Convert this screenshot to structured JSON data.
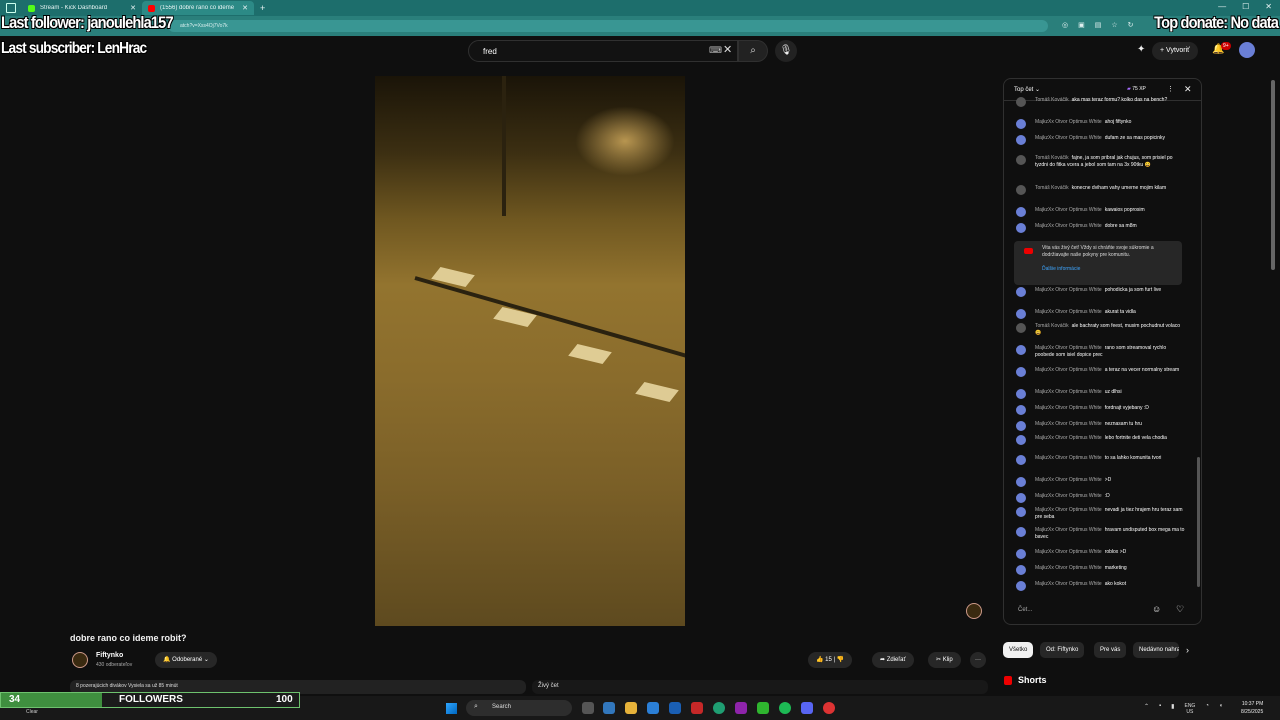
{
  "browser": {
    "tabs": [
      {
        "label": "Stream - Kick Dashboard",
        "color": "#53fc18"
      },
      {
        "label": "(1556) dobre rano co ideme",
        "color": "#ff0000"
      }
    ],
    "url": "atch?v=Xss4Oj7Vo7k"
  },
  "overlay": {
    "last_follower": "Last follower: janoulehla157",
    "last_subscriber": "Last subscriber: LenHrac",
    "top_donate": "Top donate: No data"
  },
  "youtube": {
    "search_value": "fred",
    "create_label": "Vytvoriť",
    "notif_badge": "9+"
  },
  "video": {
    "title": "dobre rano co ideme robit?",
    "channel": "Fiftynko",
    "subscribers": "430 odberateľov",
    "subscribe_label": "Odoberané",
    "likes": "15",
    "share_label": "Zdieľať",
    "clip_label": "Klip",
    "description": "8 pozerajúcich divákov  Vysiela sa už 85 minút",
    "live_chat_label": "Živý čet"
  },
  "chat": {
    "header_title": "Top čet",
    "xp": "75 XP",
    "messages": [
      {
        "author": "Tomáš Kováčik",
        "text": "aka mas teraz formu?  kolko das na bench?",
        "type": "t"
      },
      {
        "author": "MajkzXx Otvor Optimus White",
        "text": "ahoj fiftynko",
        "type": "m"
      },
      {
        "author": "MajkzXx Otvor Optimus White",
        "text": "dufam ze sa mas popicinky",
        "type": "m"
      },
      {
        "author": "Tomáš Kováčik",
        "text": "fajne, ja som pribral jak chujus, som prisiel po tyzdni do fitka vcera a jebol som tam na 3x 90tku 😀",
        "type": "t"
      },
      {
        "author": "Tomáš Kováčik",
        "text": "konecne dviham vahy umerne mojim kilam",
        "type": "t"
      },
      {
        "author": "MajkzXx Otvor Optimus White",
        "text": "kawaios poprosim",
        "type": "m"
      },
      {
        "author": "MajkzXx Otvor Optimus White",
        "text": "dobre sa m8m",
        "type": "m"
      },
      {
        "author": "MajkzXx Otvor Optimus White",
        "text": "pohodicka ja som furt live",
        "type": "m"
      },
      {
        "author": "MajkzXx Otvor Optimus White",
        "text": "akurat ta vidla",
        "type": "m"
      },
      {
        "author": "Tomáš Kováčik",
        "text": "ale bachraty som feest, musim pochudnut volaco 😀",
        "type": "t"
      },
      {
        "author": "MajkzXx Otvor Optimus White",
        "text": "rano som streamoval rychlo poobede som isiel dopice prec",
        "type": "m"
      },
      {
        "author": "MajkzXx Otvor Optimus White",
        "text": "a teraz na vecer normalny stream",
        "type": "m"
      },
      {
        "author": "MajkzXx Otvor Optimus White",
        "text": "uz dlhsi",
        "type": "m"
      },
      {
        "author": "MajkzXx Otvor Optimus White",
        "text": "fordnajt vyjebany :D",
        "type": "m"
      },
      {
        "author": "MajkzXx Otvor Optimus White",
        "text": "neznasam tu hru",
        "type": "m"
      },
      {
        "author": "MajkzXx Otvor Optimus White",
        "text": "lebo fortnite deti vela chodia",
        "type": "m"
      },
      {
        "author": "MajkzXx Otvor Optimus White",
        "text": "to sa lahko komunita tvori",
        "type": "m"
      },
      {
        "author": "MajkzXx Otvor Optimus White",
        "text": ">D",
        "type": "m"
      },
      {
        "author": "MajkzXx Otvor Optimus White",
        "text": ":D",
        "type": "m"
      },
      {
        "author": "MajkzXx Otvor Optimus White",
        "text": "nevadi ja tiez hrajem hru teraz sam pre seba",
        "type": "m"
      },
      {
        "author": "MajkzXx Otvor Optimus White",
        "text": "hravam undisputed box mega ma to bavec",
        "type": "m"
      },
      {
        "author": "MajkzXx Otvor Optimus White",
        "text": "roblox >D",
        "type": "m"
      },
      {
        "author": "MajkzXx Otvor Optimus White",
        "text": "marketing",
        "type": "m"
      },
      {
        "author": "MajkzXx Otvor Optimus White",
        "text": "ako kokot",
        "type": "m"
      }
    ],
    "notice_text": "Vita vás živý čet! Vždy si chráňte svoje súkromie a dodržiavajte naše pokyny pre komunitu.",
    "notice_link": "Ďalšie informácie",
    "input_placeholder": "Čet..."
  },
  "chips": [
    "Všetko",
    "Od: Fiftynko",
    "Pre vás",
    "Nedávno nahrané"
  ],
  "shorts_label": "Shorts",
  "followers_bar": {
    "current": "34",
    "label": "FOLLOWERS",
    "goal": "100",
    "progress": 0.34,
    "weather": "Clear"
  },
  "taskbar": {
    "search_label": "Search",
    "lang": "ENG",
    "lang2": "US",
    "time": "10:37 PM",
    "date": "8/25/2025"
  }
}
